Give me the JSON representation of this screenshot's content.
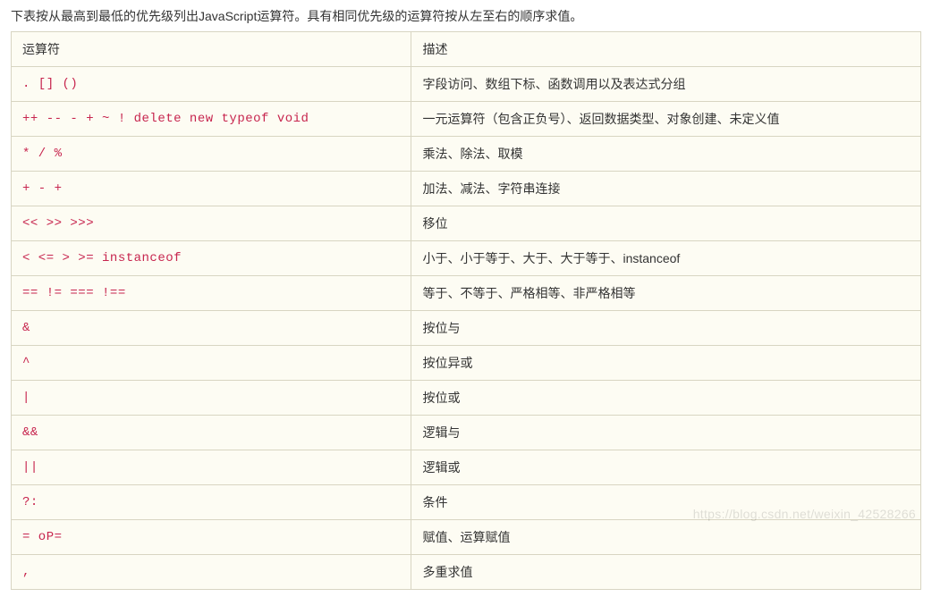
{
  "intro": "下表按从最高到最低的优先级列出JavaScript运算符。具有相同优先级的运算符按从左至右的顺序求值。",
  "headers": {
    "operator": "运算符",
    "description": "描述"
  },
  "rows": [
    {
      "operator": ". [] ()",
      "description": "字段访问、数组下标、函数调用以及表达式分组"
    },
    {
      "operator": "++ -- - + ~ ! delete new typeof void",
      "description": "一元运算符（包含正负号）、返回数据类型、对象创建、未定义值"
    },
    {
      "operator": "* / %",
      "description": "乘法、除法、取模"
    },
    {
      "operator": "+ - +",
      "description": "加法、减法、字符串连接"
    },
    {
      "operator": "<< >> >>>",
      "description": "移位"
    },
    {
      "operator": "< <= > >= instanceof",
      "description": "小于、小于等于、大于、大于等于、instanceof"
    },
    {
      "operator": "== != === !==",
      "description": "等于、不等于、严格相等、非严格相等"
    },
    {
      "operator": "&",
      "description": "按位与"
    },
    {
      "operator": "^",
      "description": "按位异或"
    },
    {
      "operator": "|",
      "description": "按位或"
    },
    {
      "operator": "&&",
      "description": "逻辑与"
    },
    {
      "operator": "||",
      "description": "逻辑或"
    },
    {
      "operator": "?:",
      "description": "条件"
    },
    {
      "operator": "= oP=",
      "description": "赋值、运算赋值"
    },
    {
      "operator": ",",
      "description": "多重求值"
    }
  ],
  "watermark": "https://blog.csdn.net/weixin_42528266"
}
